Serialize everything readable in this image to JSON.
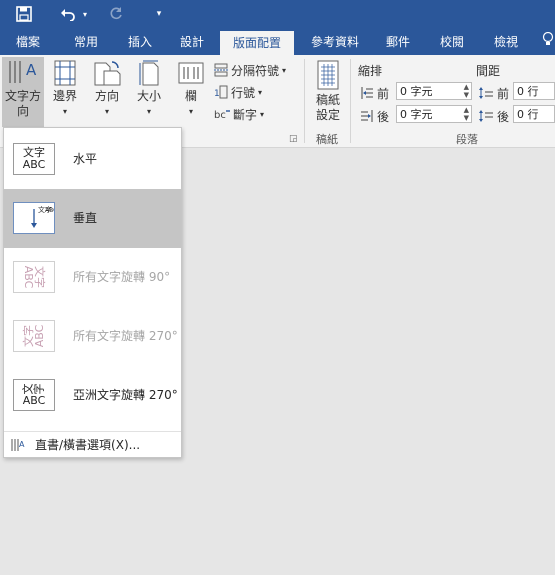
{
  "qat": {
    "save_icon": "save-icon",
    "undo_icon": "undo-icon",
    "redo_icon": "redo-icon",
    "customize_icon": "customize-qat-icon"
  },
  "tabs": [
    {
      "label": "檔案"
    },
    {
      "label": "常用"
    },
    {
      "label": "插入"
    },
    {
      "label": "設計"
    },
    {
      "label": "版面配置",
      "active": true
    },
    {
      "label": "參考資料"
    },
    {
      "label": "郵件"
    },
    {
      "label": "校閱"
    },
    {
      "label": "檢視"
    }
  ],
  "ribbon": {
    "text_direction": {
      "line1": "文字方",
      "line2": "向"
    },
    "margins": {
      "label": "邊界"
    },
    "orientation": {
      "label": "方向"
    },
    "size": {
      "label": "大小"
    },
    "columns": {
      "label": "欄"
    },
    "breaks": {
      "label": "分隔符號"
    },
    "line_numbers": {
      "label": "行號"
    },
    "hyphenation": {
      "label": "斷字"
    },
    "manuscript": {
      "line1": "稿紙",
      "line2": "設定",
      "group": "稿紙"
    },
    "indent": {
      "title": "縮排",
      "before_label": "前",
      "before_value": "0 字元",
      "after_label": "後",
      "after_value": "0 字元"
    },
    "spacing": {
      "title": "間距",
      "before_label": "前",
      "before_value": "0 行",
      "after_label": "後",
      "after_value": "0 行"
    },
    "paragraph_group": "段落"
  },
  "menu": {
    "options": [
      {
        "label": "水平",
        "thumb": "文字\nABC",
        "disabled": false,
        "selected": false
      },
      {
        "label": "垂直",
        "thumb": "文字\nABC",
        "disabled": false,
        "selected": true
      },
      {
        "label": "所有文字旋轉 90°",
        "thumb": "文字\nABC",
        "disabled": true,
        "selected": false
      },
      {
        "label": "所有文字旋轉 270°",
        "thumb": "文字\nABC",
        "disabled": true,
        "selected": false
      },
      {
        "label": "亞洲文字旋轉 270°",
        "thumb": "文字\nABC",
        "disabled": false,
        "selected": false
      }
    ],
    "footer": "直書/橫書選項(X)..."
  }
}
